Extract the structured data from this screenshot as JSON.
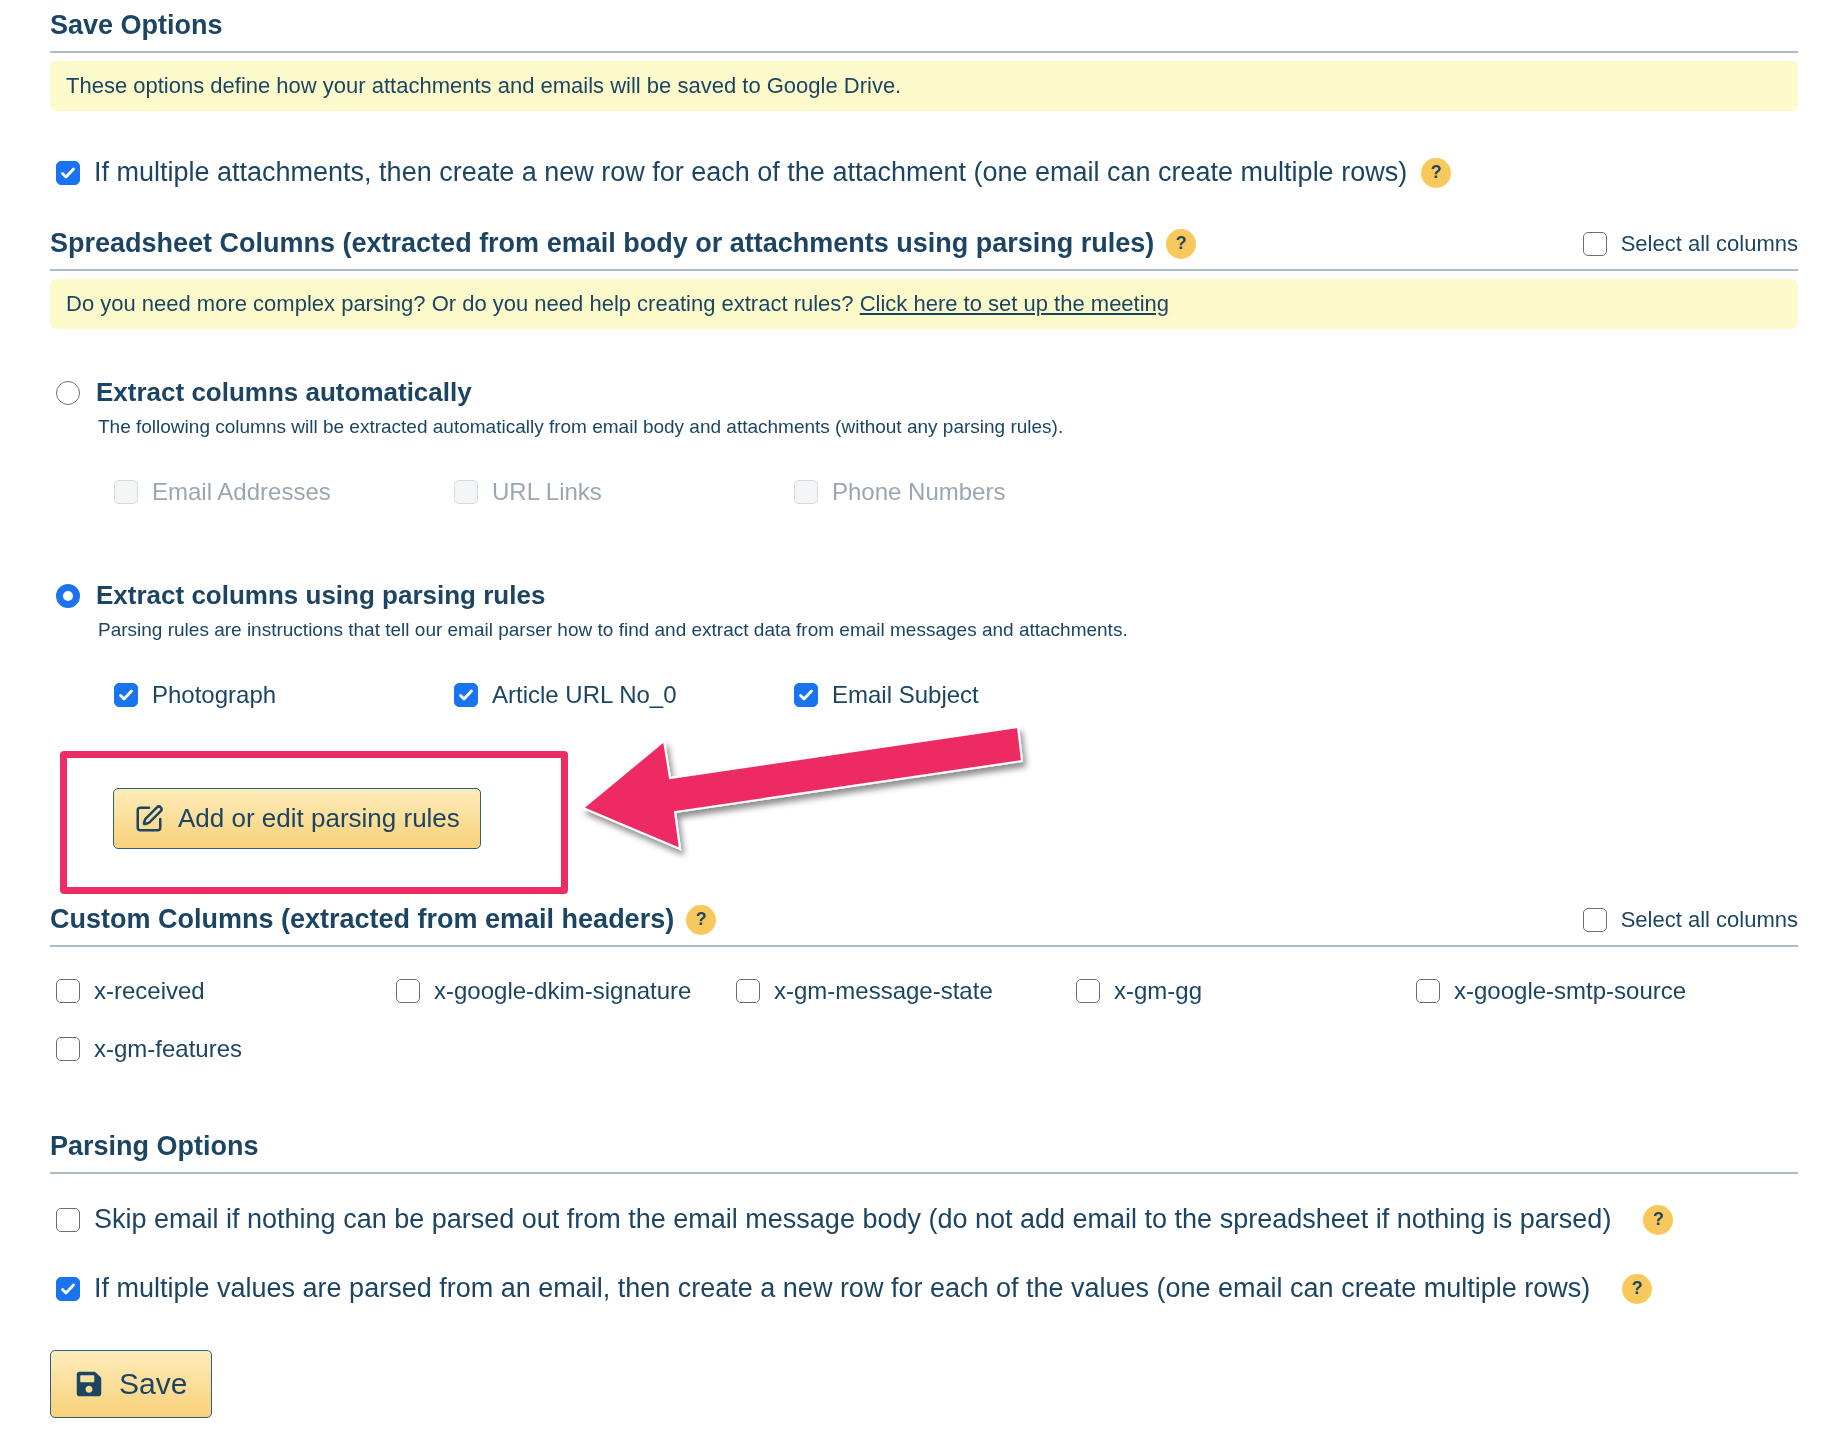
{
  "save_options": {
    "title": "Save Options",
    "info": "These options define how your attachments and emails will be saved to Google Drive.",
    "option": {
      "label": "If multiple attachments, then create a new row for each of the attachment (one email can create multiple rows)",
      "checked": true,
      "help": "?"
    }
  },
  "spreadsheet_columns": {
    "title": "Spreadsheet Columns (extracted from email body or attachments using parsing rules)",
    "help": "?",
    "select_all": {
      "label": "Select all columns",
      "checked": false
    },
    "info": {
      "text": "Do you need more complex parsing? Or do you need help creating extract rules?",
      "link": "Click here to set up the meeting"
    },
    "modes": [
      {
        "label": "Extract columns automatically",
        "selected": false,
        "description": "The following columns will be extracted automatically from email body and attachments (without any parsing rules).",
        "columns": [
          {
            "label": "Email Addresses",
            "checked": false,
            "disabled": true
          },
          {
            "label": "URL Links",
            "checked": false,
            "disabled": true
          },
          {
            "label": "Phone Numbers",
            "checked": false,
            "disabled": true
          }
        ]
      },
      {
        "label": "Extract columns using parsing rules",
        "selected": true,
        "description": "Parsing rules are instructions that tell our email parser how to find and extract data from email messages and attachments.",
        "columns": [
          {
            "label": "Photograph",
            "checked": true,
            "disabled": false
          },
          {
            "label": "Article URL No_0",
            "checked": true,
            "disabled": false
          },
          {
            "label": "Email Subject",
            "checked": true,
            "disabled": false
          }
        ],
        "button": {
          "label": "Add or edit parsing rules",
          "annotated": true
        }
      }
    ]
  },
  "custom_columns": {
    "title": "Custom Columns (extracted from email headers)",
    "help": "?",
    "select_all": {
      "label": "Select all columns",
      "checked": false
    },
    "columns": [
      {
        "label": "x-received",
        "checked": false
      },
      {
        "label": "x-google-dkim-signature",
        "checked": false
      },
      {
        "label": "x-gm-message-state",
        "checked": false
      },
      {
        "label": "x-gm-gg",
        "checked": false
      },
      {
        "label": "x-google-smtp-source",
        "checked": false
      },
      {
        "label": "x-gm-features",
        "checked": false
      }
    ]
  },
  "parsing_options": {
    "title": "Parsing Options",
    "options": [
      {
        "label": "Skip email if nothing can be parsed out from the email message body (do not add email to the spreadsheet if nothing is parsed)",
        "checked": false,
        "help": "?"
      },
      {
        "label": "If multiple values are parsed from an email, then create a new row for each of the values (one email can create multiple rows)",
        "checked": true,
        "help": "?"
      }
    ]
  },
  "save_button": {
    "label": "Save"
  }
}
